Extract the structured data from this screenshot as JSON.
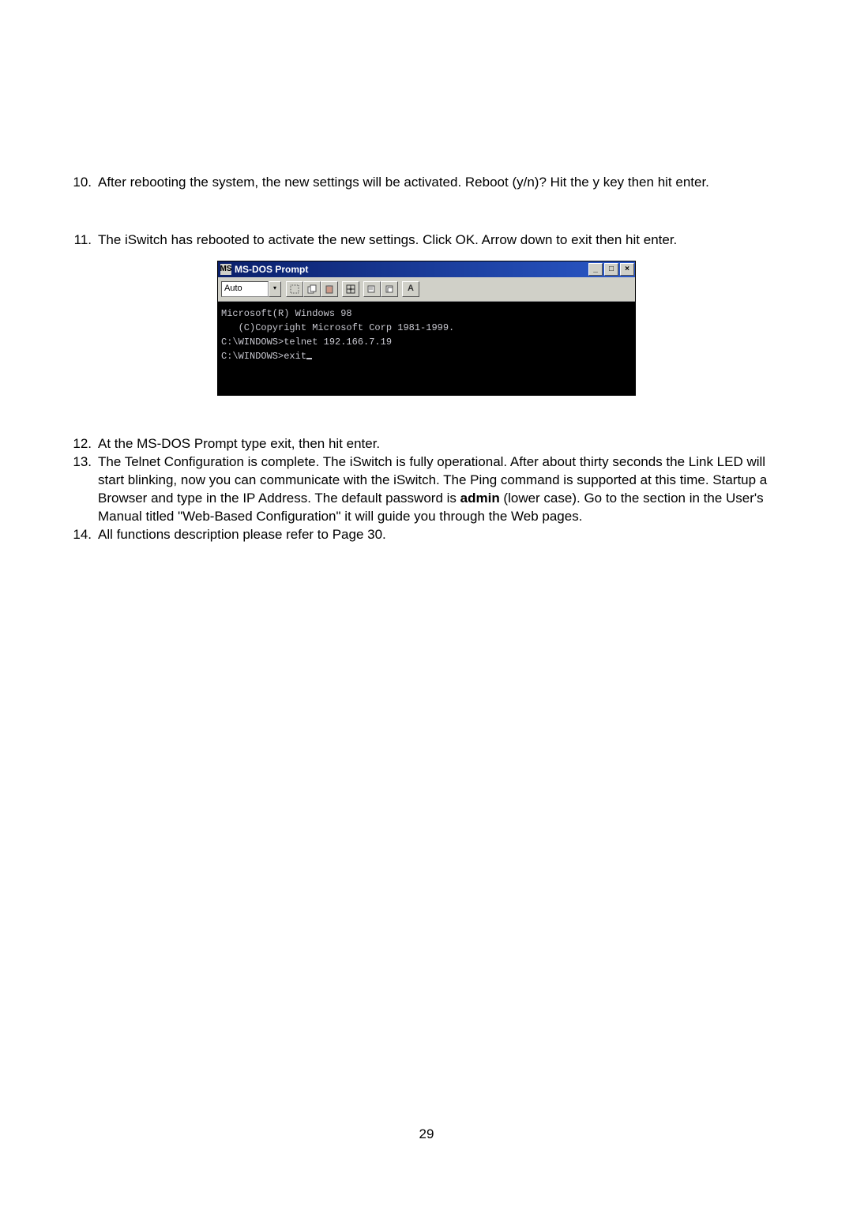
{
  "steps": {
    "s10": {
      "num": "10.",
      "text": "After rebooting the system, the new settings will be activated.  Reboot (y/n)?  Hit the y key then hit enter."
    },
    "s11": {
      "num": "11.",
      "text": "The iSwitch has rebooted to activate the new settings.  Click OK.  Arrow down to exit then hit enter."
    },
    "s12": {
      "num": "12.",
      "text": "At the MS-DOS Prompt type exit, then hit enter."
    },
    "s13": {
      "num": "13.",
      "pre": "The Telnet Configuration is complete.  The iSwitch is fully operational.  After about thirty seconds the Link LED will start blinking, now you can communicate with the iSwitch.  The Ping command is supported at this time.  Startup a Browser and type in the IP Address.  The default password is ",
      "bold": "admin",
      "post": " (lower case).  Go to the section in the User's Manual titled \"Web-Based Configuration\" it will guide you through the Web pages."
    },
    "s14": {
      "num": "14.",
      "text": "All functions description please refer to Page 30."
    }
  },
  "dos": {
    "title": "MS-DOS Prompt",
    "auto": "Auto",
    "min": "_",
    "max": "□",
    "close": "×",
    "dropdown_arrow": "▾",
    "tool_font": "A",
    "lines": {
      "l1": "Microsoft(R) Windows 98",
      "l2": "   (C)Copyright Microsoft Corp 1981-1999.",
      "l3": "",
      "l4": "C:\\WINDOWS>telnet 192.166.7.19",
      "l5": "",
      "l6_prompt": "C:\\WINDOWS>",
      "l6_cmd": "exit"
    }
  },
  "page_number": "29"
}
